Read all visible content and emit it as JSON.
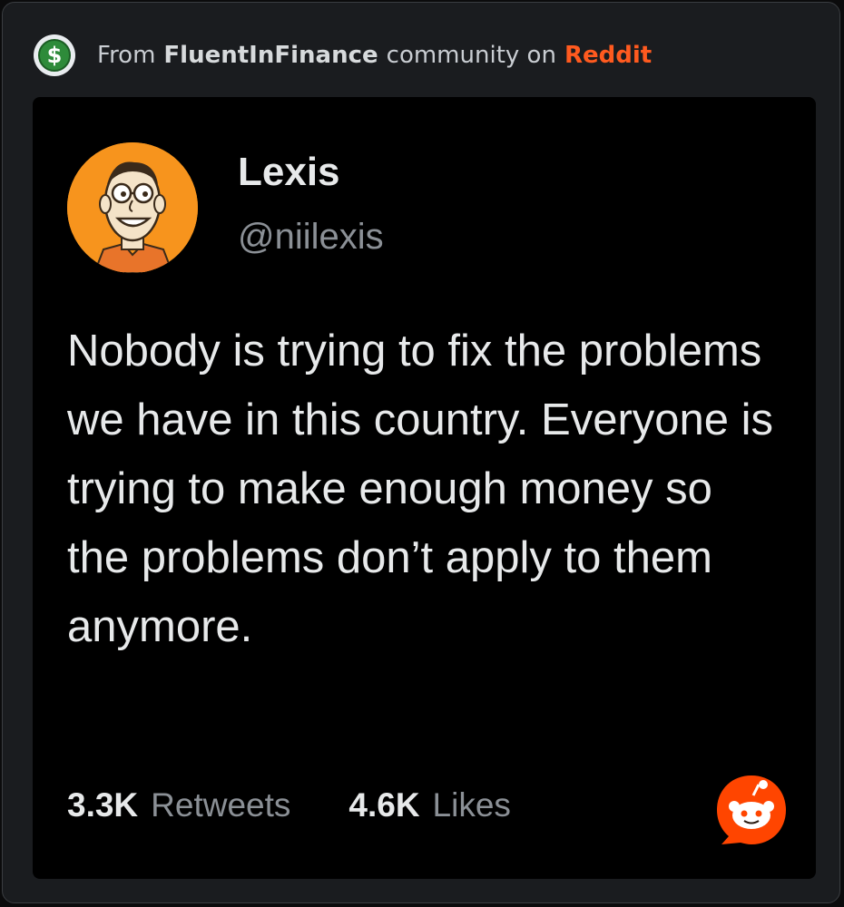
{
  "header": {
    "prefix": "From",
    "community": "FluentInFinance",
    "middle": "community on",
    "platform": "Reddit",
    "community_icon": "dollar-sign-icon"
  },
  "tweet": {
    "display_name": "Lexis",
    "handle": "@niilexis",
    "text": "Nobody is trying to fix the problems we have in this country. Everyone is trying to make enough money so the problems don’t apply to them anymore.",
    "retweets_count": "3.3K",
    "retweets_label": "Retweets",
    "likes_count": "4.6K",
    "likes_label": "Likes"
  },
  "icons": {
    "avatar": "cartoon-face-avatar",
    "reddit_logo": "reddit-snoo-icon"
  },
  "colors": {
    "reddit_orange": "#ff4500",
    "avatar_bg": "#f7941d",
    "card_bg": "#000000",
    "frame_bg": "#1a1c1f"
  }
}
